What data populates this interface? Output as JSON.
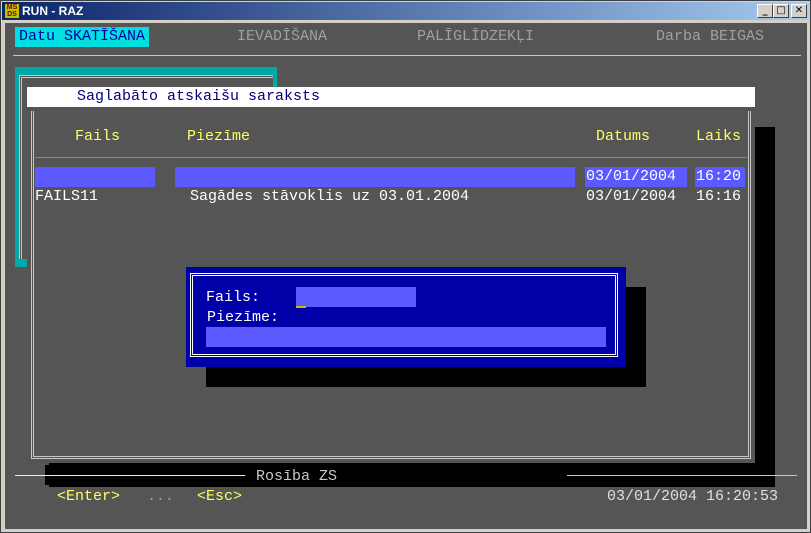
{
  "window": {
    "title": "RUN - RAZ",
    "icon_text": "MS DS"
  },
  "menu": [
    {
      "label": "Datu SKATĪŠANA",
      "active": true
    },
    {
      "label": "IEVADĪŠANA",
      "active": false
    },
    {
      "label": "PALĪGLĪDZEKĻI",
      "active": false
    },
    {
      "label": "Darba BEIGAS",
      "active": false
    }
  ],
  "panel": {
    "title": "Saglabāto atskaišu saraksts",
    "columns": {
      "fails": "Fails",
      "piezime": "Piezīme",
      "datums": "Datums",
      "laiks": "Laiks"
    },
    "rows": [
      {
        "fails": "",
        "piezime": "",
        "datums": "03/01/2004",
        "laiks": "16:20",
        "selected": true
      },
      {
        "fails": "FAILS11",
        "piezime": "Sagādes stāvoklis uz 03.01.2004",
        "datums": "03/01/2004",
        "laiks": "16:16",
        "selected": false
      }
    ]
  },
  "dialog": {
    "fails_label": "Fails:",
    "fails_value": "",
    "piezime_label": "Piezīme:",
    "piezime_value": ""
  },
  "status": {
    "title": "Rosība ZS",
    "enter_key": "<Enter>",
    "separator": "...",
    "esc_key": "<Esc>",
    "datetime": "03/01/2004 16:20:53"
  },
  "colors": {
    "background": "#555555",
    "highlight": "#5a5aff",
    "dialog": "#0000a8",
    "menu_active": "#00e0e0",
    "text_yellow": "#ffff60"
  }
}
